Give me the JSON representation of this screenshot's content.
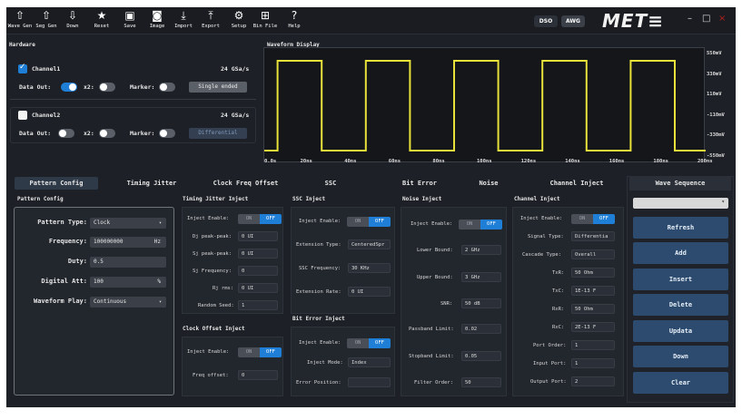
{
  "toolbar": {
    "buttons": [
      {
        "icon": "upload-icon",
        "glyph": "⇧",
        "label": "Wave Gen"
      },
      {
        "icon": "upload-icon",
        "glyph": "⇧",
        "label": "Seg Gen"
      },
      {
        "icon": "download-icon",
        "glyph": "⇩",
        "label": "Down"
      },
      {
        "icon": "star-icon",
        "glyph": "★",
        "label": "Reset"
      },
      {
        "icon": "save-icon",
        "glyph": "▣",
        "label": "Save"
      },
      {
        "icon": "camera-icon",
        "glyph": "◙",
        "label": "Image"
      },
      {
        "icon": "import-icon",
        "glyph": "⤓",
        "label": "Import"
      },
      {
        "icon": "export-icon",
        "glyph": "⤒",
        "label": "Export"
      },
      {
        "icon": "gear-icon",
        "glyph": "⚙",
        "label": "Setup"
      },
      {
        "icon": "bin-file-icon",
        "glyph": "⊞",
        "label": "Bin File"
      },
      {
        "icon": "help-icon",
        "glyph": "?",
        "label": "Help"
      }
    ],
    "mode_dso": "DSO",
    "mode_awg": "AWG",
    "logo": "MET≡",
    "minimize": "–",
    "maximize": "□",
    "close": "×"
  },
  "hardware": {
    "title": "Hardware",
    "channel1": {
      "name": "Channel1",
      "rate": "24 GSa/s",
      "checked": true,
      "data_out_label": "Data Out:",
      "data_out": true,
      "x2_label": "x2:",
      "x2": false,
      "marker_label": "Marker:",
      "marker": false,
      "mode_button": "Single ended"
    },
    "channel2": {
      "name": "Channel2",
      "rate": "24 GSa/s",
      "checked": false,
      "data_out_label": "Data Out:",
      "data_out": false,
      "x2_label": "x2:",
      "x2": false,
      "marker_label": "Marker:",
      "marker": false,
      "mode_button": "Differential"
    }
  },
  "waveform": {
    "title": "Waveform Display",
    "y_ticks": [
      "550mV",
      "330mV",
      "110mV",
      "-110mV",
      "-330mV",
      "-550mV"
    ],
    "x_ticks": [
      "0.0s",
      "20ns",
      "40ns",
      "60ns",
      "80ns",
      "100ns",
      "120ns",
      "140ns",
      "160ns",
      "180ns",
      "200ns"
    ],
    "trace_color": "#e8e23a",
    "high_mv": 500,
    "low_mv": -500,
    "period_ns": 40,
    "end_ns": 200
  },
  "tabs": [
    "Pattern Config",
    "Timing Jitter",
    "Clock Freq Offset",
    "SSC",
    "Bit Error",
    "Noise",
    "Channel Inject"
  ],
  "wave_sequence": {
    "title": "Wave Sequence",
    "dropdown_value": "",
    "buttons": [
      "Refresh",
      "Add",
      "Insert",
      "Delete",
      "Updata",
      "Down",
      "Clear"
    ]
  },
  "pattern_config": {
    "title": "Pattern Config",
    "pattern_type_label": "Pattern Type:",
    "pattern_type": "Clock",
    "frequency_label": "Frequency:",
    "frequency": "100000000",
    "frequency_unit": "Hz",
    "duty_label": "Duty:",
    "duty": "0.5",
    "digital_att_label": "Digital Att:",
    "digital_att": "100",
    "digital_att_unit": "%",
    "waveform_play_label": "Waveform Play:",
    "waveform_play": "Continuous"
  },
  "onoff": {
    "on": "ON",
    "off": "OFF"
  },
  "timing_jitter": {
    "title": "Timing Jitter Inject",
    "inject_label": "Inject Enable:",
    "dj_label": "Dj peak-peak:",
    "dj": "0 UI",
    "sj_label": "Sj peak-peak:",
    "sj": "0 UI",
    "sjf_label": "Sj Frequency:",
    "sjf": "0",
    "rj_label": "Rj rms:",
    "rj": "0 UI",
    "seed_label": "Random Seed:",
    "seed": "1"
  },
  "clock_offset": {
    "title": "Clock Offset Inject",
    "inject_label": "Inject Enable:",
    "freq_label": "Freq offset:",
    "freq": "0"
  },
  "ssc": {
    "title": "SSC Inject",
    "inject_label": "Inject Enable:",
    "ext_type_label": "Extension Type:",
    "ext_type": "CenteredSpr",
    "ssc_freq_label": "SSC Frequency:",
    "ssc_freq": "30 KHz",
    "ext_rate_label": "Extension Rate:",
    "ext_rate": "0 UI"
  },
  "bit_error": {
    "title": "Bit Error Inject",
    "inject_label": "Inject Enable:",
    "mode_label": "Inject Mode:",
    "mode": "Index",
    "pos_label": "Error Position:",
    "pos": ""
  },
  "noise": {
    "title": "Noise Inject",
    "inject_label": "Inject Enable:",
    "lower_label": "Lower Bound:",
    "lower": "2 GHz",
    "upper_label": "Upper Bound:",
    "upper": "3 GHz",
    "snr_label": "SNR:",
    "snr": "50 dB",
    "pass_label": "Passband Limit:",
    "pass": "0.02",
    "stop_label": "Stopband Limit:",
    "stop": "0.05",
    "order_label": "Filter Order:",
    "order": "50"
  },
  "channel_inject": {
    "title": "Channel Inject",
    "inject_label": "Inject Enable:",
    "signal_label": "Signal Type:",
    "signal": "Differentia",
    "cascade_label": "Cascade Type:",
    "cascade": "Overall",
    "txr_label": "TxR:",
    "txr": "50 Ohm",
    "txc_label": "TxC:",
    "txc": "1E-13 F",
    "rxr_label": "RxR:",
    "rxr": "50 Ohm",
    "rxc_label": "RxC:",
    "rxc": "2E-13 F",
    "port_order_label": "Port Order:",
    "port_order": "1",
    "input_port_label": "Input Port:",
    "input_port": "1",
    "output_port_label": "Output Port:",
    "output_port": "2"
  }
}
